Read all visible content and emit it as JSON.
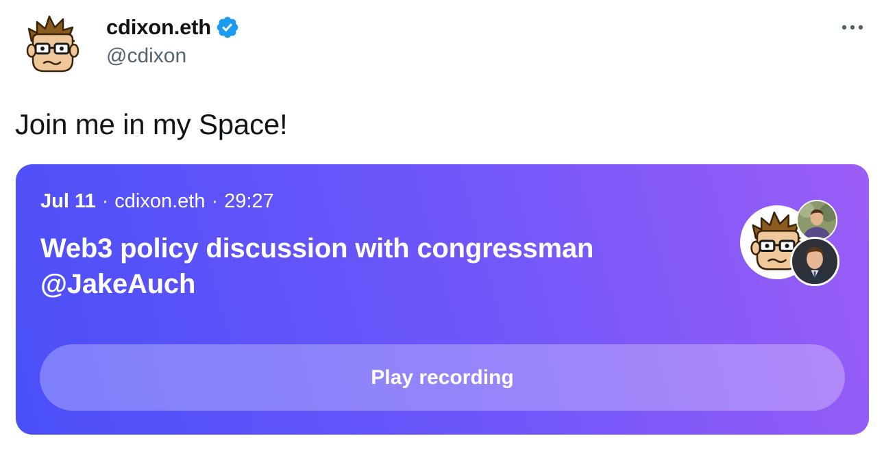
{
  "author": {
    "display_name": "cdixon.eth",
    "handle": "@cdixon",
    "verified": true,
    "avatar_icon": "cartoon-face-avatar"
  },
  "more_icon": "more-dots-icon",
  "tweet": {
    "text": "Join me in my Space!"
  },
  "space": {
    "date": "Jul 11",
    "separator": "·",
    "host": "cdixon.eth",
    "duration": "29:27",
    "title": "Web3 policy discussion with congressman @JakeAuch",
    "play_label": "Play recording",
    "gradient_colors": [
      "#4a4ff8",
      "#6c56fa",
      "#9b5df6"
    ]
  },
  "colors": {
    "text_primary": "#0f1419",
    "text_secondary": "#536471",
    "verified_blue": "#1d9bf0"
  }
}
